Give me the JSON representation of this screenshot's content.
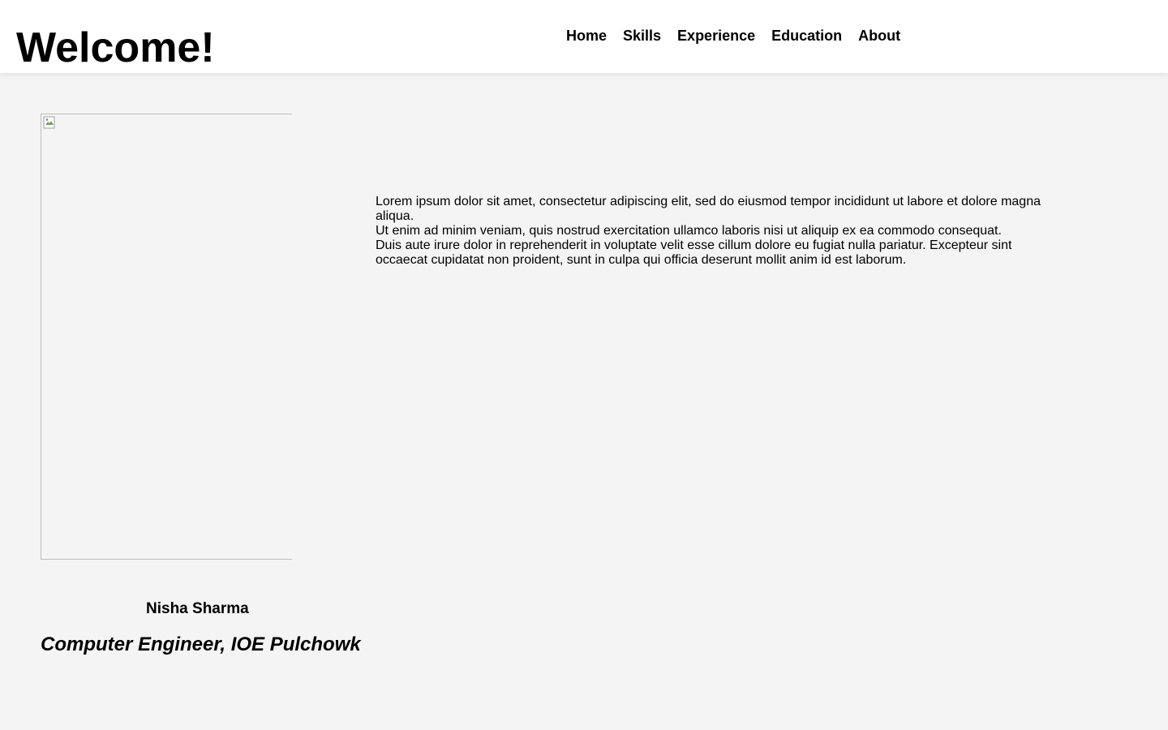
{
  "header": {
    "title": "Welcome!",
    "nav": [
      {
        "label": "Home"
      },
      {
        "label": "Skills"
      },
      {
        "label": "Experience"
      },
      {
        "label": "Education"
      },
      {
        "label": "About"
      }
    ]
  },
  "profile": {
    "name": "Nisha Sharma",
    "role": "Computer Engineer, IOE Pulchowk",
    "image_icon": "broken-image-icon"
  },
  "bio": {
    "paragraphs": [
      "Lorem ipsum dolor sit amet, consectetur adipiscing elit, sed do eiusmod tempor incididunt ut labore et dolore magna aliqua.",
      "Ut enim ad minim veniam, quis nostrud exercitation ullamco laboris nisi ut aliquip ex ea commodo consequat.",
      "Duis aute irure dolor in reprehenderit in voluptate velit esse cillum dolore eu fugiat nulla pariatur. Excepteur sint occaecat cupidatat non proident, sunt in culpa qui officia deserunt mollit anim id est laborum."
    ]
  },
  "colors": {
    "page_background": "#f4f4f4",
    "header_background": "#ffffff",
    "text": "#000000"
  }
}
